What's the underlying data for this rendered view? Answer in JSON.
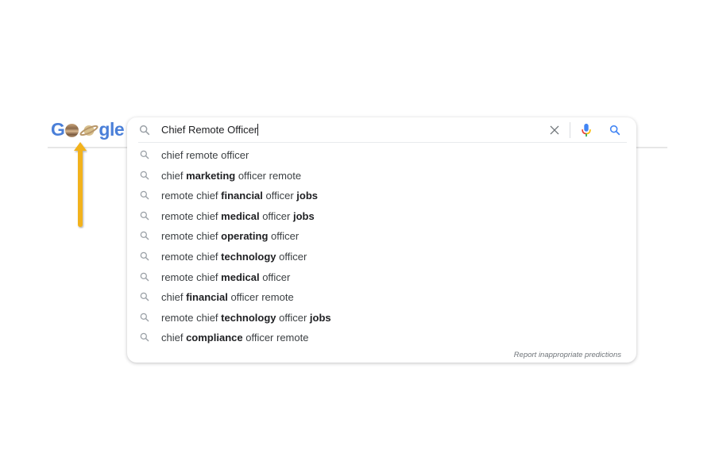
{
  "logo": {
    "letters": [
      "G",
      "gle"
    ],
    "alt": "Google doodle with planets"
  },
  "annotation": {
    "arrow_color": "#f2b21d",
    "arrow_direction": "up"
  },
  "search": {
    "query": "Chief Remote Officer",
    "icons": {
      "left": "search-icon",
      "clear": "close-icon",
      "voice": "microphone-icon",
      "submit": "search-icon"
    }
  },
  "suggestions": [
    {
      "parts": [
        {
          "t": "chief remote officer",
          "b": false
        }
      ]
    },
    {
      "parts": [
        {
          "t": "chief ",
          "b": false
        },
        {
          "t": "marketing",
          "b": true
        },
        {
          "t": " officer remote",
          "b": false
        }
      ]
    },
    {
      "parts": [
        {
          "t": "remote chief ",
          "b": false
        },
        {
          "t": "financial",
          "b": true
        },
        {
          "t": " officer ",
          "b": false
        },
        {
          "t": "jobs",
          "b": true
        }
      ]
    },
    {
      "parts": [
        {
          "t": "remote chief ",
          "b": false
        },
        {
          "t": "medical",
          "b": true
        },
        {
          "t": " officer ",
          "b": false
        },
        {
          "t": "jobs",
          "b": true
        }
      ]
    },
    {
      "parts": [
        {
          "t": "remote chief ",
          "b": false
        },
        {
          "t": "operating",
          "b": true
        },
        {
          "t": " officer",
          "b": false
        }
      ]
    },
    {
      "parts": [
        {
          "t": "remote chief ",
          "b": false
        },
        {
          "t": "technology",
          "b": true
        },
        {
          "t": " officer",
          "b": false
        }
      ]
    },
    {
      "parts": [
        {
          "t": "remote chief ",
          "b": false
        },
        {
          "t": "medical",
          "b": true
        },
        {
          "t": " officer",
          "b": false
        }
      ]
    },
    {
      "parts": [
        {
          "t": "chief ",
          "b": false
        },
        {
          "t": "financial",
          "b": true
        },
        {
          "t": " officer remote",
          "b": false
        }
      ]
    },
    {
      "parts": [
        {
          "t": "remote chief ",
          "b": false
        },
        {
          "t": "technology",
          "b": true
        },
        {
          "t": " officer ",
          "b": false
        },
        {
          "t": "jobs",
          "b": true
        }
      ]
    },
    {
      "parts": [
        {
          "t": "chief ",
          "b": false
        },
        {
          "t": "compliance",
          "b": true
        },
        {
          "t": " officer remote",
          "b": false
        }
      ]
    }
  ],
  "report_link": "Report inappropriate predictions",
  "colors": {
    "logo_blue": "#4a7fd8",
    "mic_blue": "#4285f4",
    "mic_red": "#ea4335",
    "mic_yellow": "#fbbc05",
    "mic_green": "#34a853",
    "icon_gray": "#9aa0a6",
    "submit_blue": "#4285f4"
  }
}
